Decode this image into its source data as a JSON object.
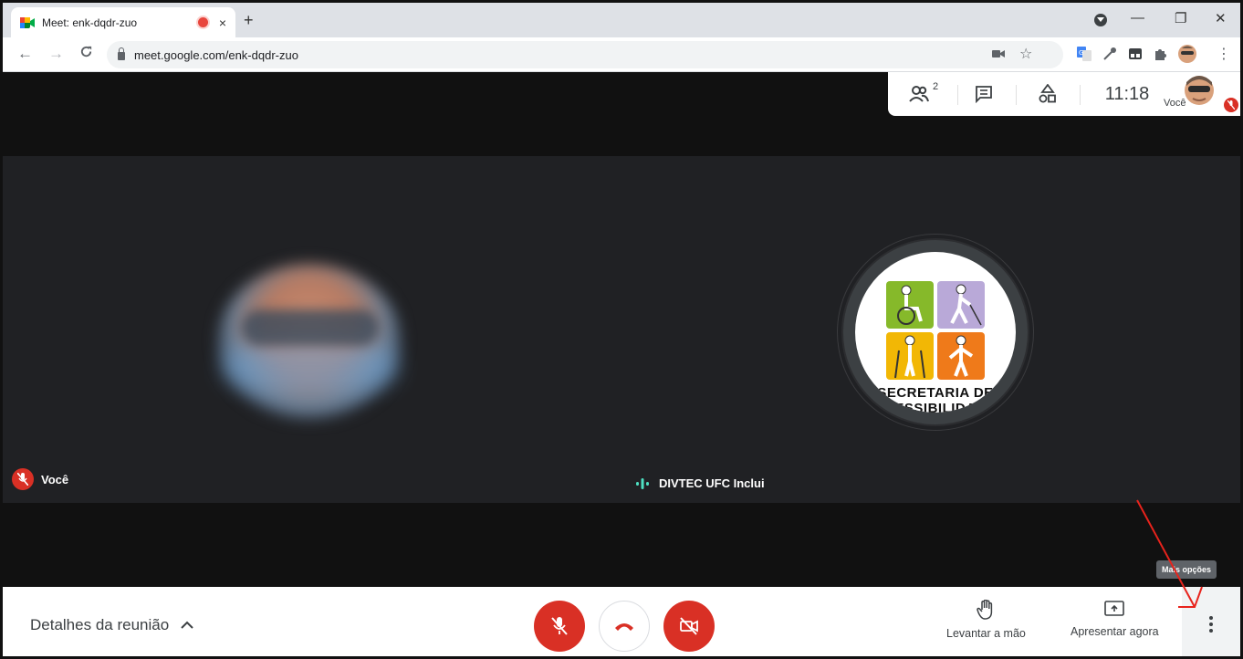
{
  "browser": {
    "tab_title": "Meet: enk-dqdr-zuo",
    "tab_close": "×",
    "new_tab": "+",
    "url": "meet.google.com/enk-dqdr-zuo",
    "window_minimize": "—",
    "window_restore": "❐",
    "window_close": "✕"
  },
  "meet": {
    "topbar": {
      "participants_count": "2",
      "clock": "11:18",
      "self_label": "Você"
    },
    "tiles": [
      {
        "name": "Você",
        "mic_muted": true
      },
      {
        "name": "DIVTEC UFC Inclui",
        "speaking": true,
        "logo_text_line1": "SECRETARIA DE",
        "logo_text_line2": "ESSIBILIDA"
      }
    ],
    "tooltip": "Mais opções"
  },
  "bottombar": {
    "details_label": "Detalhes da reunião",
    "raise_hand_label": "Levantar a mão",
    "present_label": "Apresentar agora"
  },
  "colors": {
    "red": "#d93025",
    "meet_dark": "#202124",
    "green_speaking": "#4ee0c2",
    "logo_green": "#86b92a",
    "logo_purple": "#b9a9d8",
    "logo_yellow": "#f2b705",
    "logo_orange": "#ef7a1a"
  }
}
